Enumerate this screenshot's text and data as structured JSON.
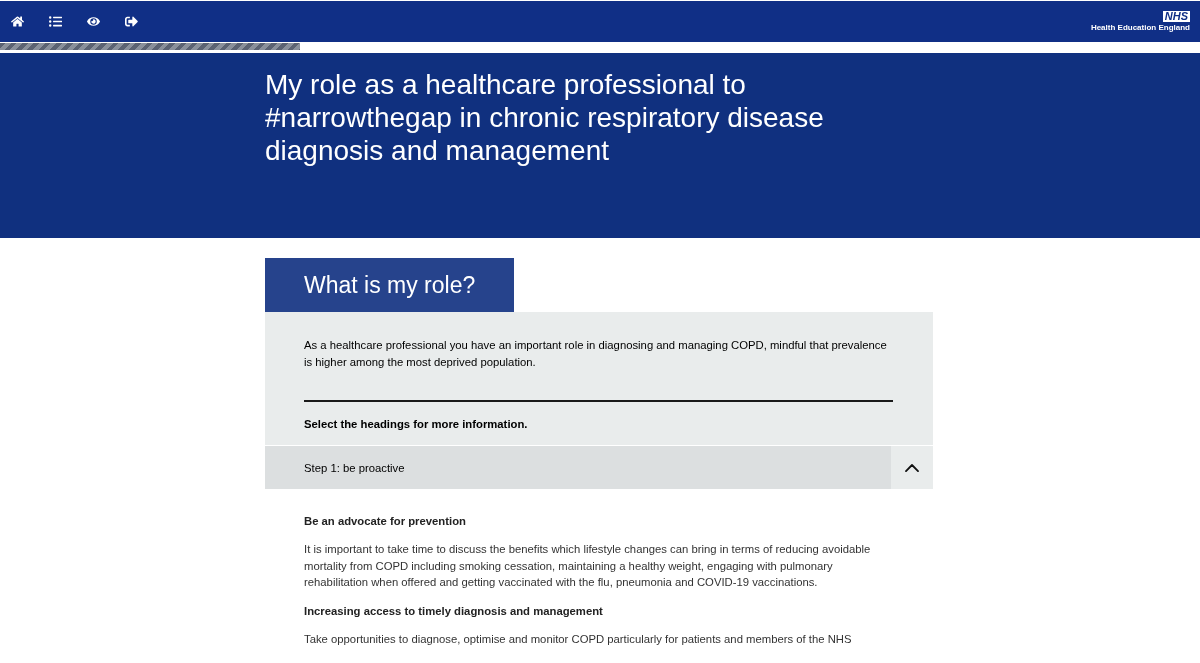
{
  "logo": {
    "mark": "NHS",
    "caption": "Health Education England"
  },
  "progress": {
    "level": 0.25
  },
  "banner": {
    "title": "My role as a healthcare professional to #narrowthegap in chronic respiratory disease diagnosis and management"
  },
  "section": {
    "heading": "What is my role?",
    "intro": "As a healthcare professional you have an important role in diagnosing and managing COPD, mindful that prevalence is higher among the most deprived population.",
    "instruction": "Select the headings for more information.",
    "accordion": [
      {
        "title": "Step 1: be proactive",
        "expanded": true,
        "content": [
          {
            "kind": "heading",
            "text": "Be an advocate for prevention"
          },
          {
            "kind": "paragraph",
            "text": "It is important to take time to discuss the benefits which lifestyle changes can bring in terms of reducing avoidable mortality from COPD including smoking cessation, maintaining a healthy weight, engaging with pulmonary rehabilitation when offered and getting vaccinated with the flu, pneumonia and COVID-19 vaccinations."
          },
          {
            "kind": "heading",
            "text": "Increasing access to timely diagnosis and management"
          },
          {
            "kind": "paragraph",
            "text": "Take opportunities to diagnose, optimise and monitor COPD particularly for patients and members of the NHS"
          }
        ]
      }
    ]
  }
}
